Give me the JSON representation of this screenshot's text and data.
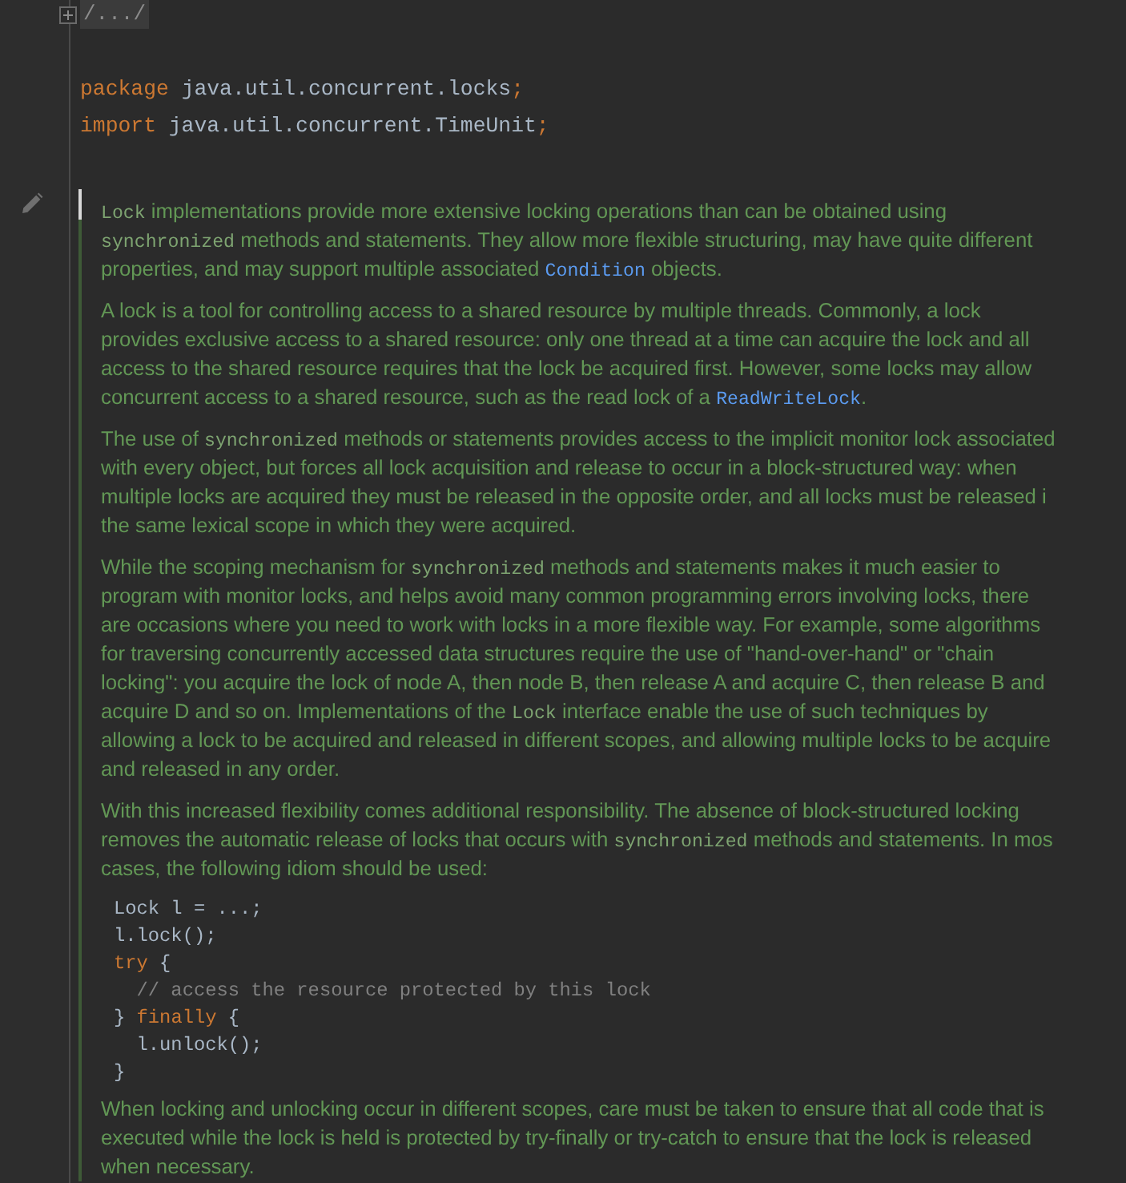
{
  "editor": {
    "folded_text": "/.../",
    "code_lines": [
      [
        {
          "kind": "keyword",
          "text": "package"
        },
        {
          "kind": "plain",
          "text": " java.util.concurrent.locks"
        },
        {
          "kind": "punct",
          "text": ";"
        }
      ],
      [
        {
          "kind": "keyword",
          "text": "import"
        },
        {
          "kind": "plain",
          "text": " java.util.concurrent.TimeUnit"
        },
        {
          "kind": "punct",
          "text": ";"
        }
      ]
    ],
    "doc_comment": {
      "blocks": [
        {
          "kind": "paragraph",
          "lines": [
            [
              {
                "kind": "code",
                "text": "Lock"
              },
              {
                "kind": "text",
                "text": " implementations provide more extensive locking operations than can be obtained using"
              }
            ],
            [
              {
                "kind": "code",
                "text": "synchronized"
              },
              {
                "kind": "text",
                "text": " methods and statements. They allow more flexible structuring, may have quite different"
              }
            ],
            [
              {
                "kind": "text",
                "text": "properties, and may support multiple associated "
              },
              {
                "kind": "link",
                "text": "Condition"
              },
              {
                "kind": "text",
                "text": " objects."
              }
            ]
          ]
        },
        {
          "kind": "paragraph",
          "lines": [
            [
              {
                "kind": "text",
                "text": "A lock is a tool for controlling access to a shared resource by multiple threads. Commonly, a lock"
              }
            ],
            [
              {
                "kind": "text",
                "text": "provides exclusive access to a shared resource: only one thread at a time can acquire the lock and all"
              }
            ],
            [
              {
                "kind": "text",
                "text": "access to the shared resource requires that the lock be acquired first. However, some locks may allow"
              }
            ],
            [
              {
                "kind": "text",
                "text": "concurrent access to a shared resource, such as the read lock of a "
              },
              {
                "kind": "link",
                "text": "ReadWriteLock"
              },
              {
                "kind": "text",
                "text": "."
              }
            ]
          ]
        },
        {
          "kind": "paragraph",
          "lines": [
            [
              {
                "kind": "text",
                "text": "The use of "
              },
              {
                "kind": "code",
                "text": "synchronized"
              },
              {
                "kind": "text",
                "text": " methods or statements provides access to the implicit monitor lock associated"
              }
            ],
            [
              {
                "kind": "text",
                "text": "with every object, but forces all lock acquisition and release to occur in a block-structured way: when"
              }
            ],
            [
              {
                "kind": "text",
                "text": "multiple locks are acquired they must be released in the opposite order, and all locks must be released i"
              }
            ],
            [
              {
                "kind": "text",
                "text": "the same lexical scope in which they were acquired."
              }
            ]
          ]
        },
        {
          "kind": "paragraph",
          "lines": [
            [
              {
                "kind": "text",
                "text": "While the scoping mechanism for "
              },
              {
                "kind": "code",
                "text": "synchronized"
              },
              {
                "kind": "text",
                "text": " methods and statements makes it much easier to"
              }
            ],
            [
              {
                "kind": "text",
                "text": "program with monitor locks, and helps avoid many common programming errors involving locks, there"
              }
            ],
            [
              {
                "kind": "text",
                "text": "are occasions where you need to work with locks in a more flexible way. For example, some algorithms"
              }
            ],
            [
              {
                "kind": "text",
                "text": "for traversing concurrently accessed data structures require the use of \"hand-over-hand\" or \"chain"
              }
            ],
            [
              {
                "kind": "text",
                "text": "locking\": you acquire the lock of node A, then node B, then release A and acquire C, then release B and"
              }
            ],
            [
              {
                "kind": "text",
                "text": "acquire D and so on. Implementations of the "
              },
              {
                "kind": "code",
                "text": "Lock"
              },
              {
                "kind": "text",
                "text": " interface enable the use of such techniques by"
              }
            ],
            [
              {
                "kind": "text",
                "text": "allowing a lock to be acquired and released in different scopes, and allowing multiple locks to be acquire"
              }
            ],
            [
              {
                "kind": "text",
                "text": "and released in any order."
              }
            ]
          ]
        },
        {
          "kind": "paragraph",
          "lines": [
            [
              {
                "kind": "text",
                "text": "With this increased flexibility comes additional responsibility. The absence of block-structured locking"
              }
            ],
            [
              {
                "kind": "text",
                "text": "removes the automatic release of locks that occurs with "
              },
              {
                "kind": "code",
                "text": "synchronized"
              },
              {
                "kind": "text",
                "text": " methods and statements. In mos"
              }
            ],
            [
              {
                "kind": "text",
                "text": "cases, the following idiom should be used:"
              }
            ]
          ]
        },
        {
          "kind": "code",
          "lines": [
            [
              {
                "kind": "plain",
                "text": "Lock l = ...;"
              }
            ],
            [
              {
                "kind": "plain",
                "text": "l.lock();"
              }
            ],
            [
              {
                "kind": "keyword",
                "text": "try"
              },
              {
                "kind": "plain",
                "text": " {"
              }
            ],
            [
              {
                "kind": "comment",
                "text": "  // access the resource protected by this lock"
              }
            ],
            [
              {
                "kind": "plain",
                "text": "} "
              },
              {
                "kind": "keyword",
                "text": "finally"
              },
              {
                "kind": "plain",
                "text": " {"
              }
            ],
            [
              {
                "kind": "plain",
                "text": "  l.unlock();"
              }
            ],
            [
              {
                "kind": "plain",
                "text": "}"
              }
            ]
          ]
        },
        {
          "kind": "paragraph",
          "lines": [
            [
              {
                "kind": "text",
                "text": "When locking and unlocking occur in different scopes, care must be taken to ensure that all code that is"
              }
            ],
            [
              {
                "kind": "text",
                "text": "executed while the lock is held is protected by try-finally or try-catch to ensure that the lock is released"
              }
            ],
            [
              {
                "kind": "text",
                "text": "when necessary."
              }
            ]
          ]
        }
      ]
    }
  }
}
